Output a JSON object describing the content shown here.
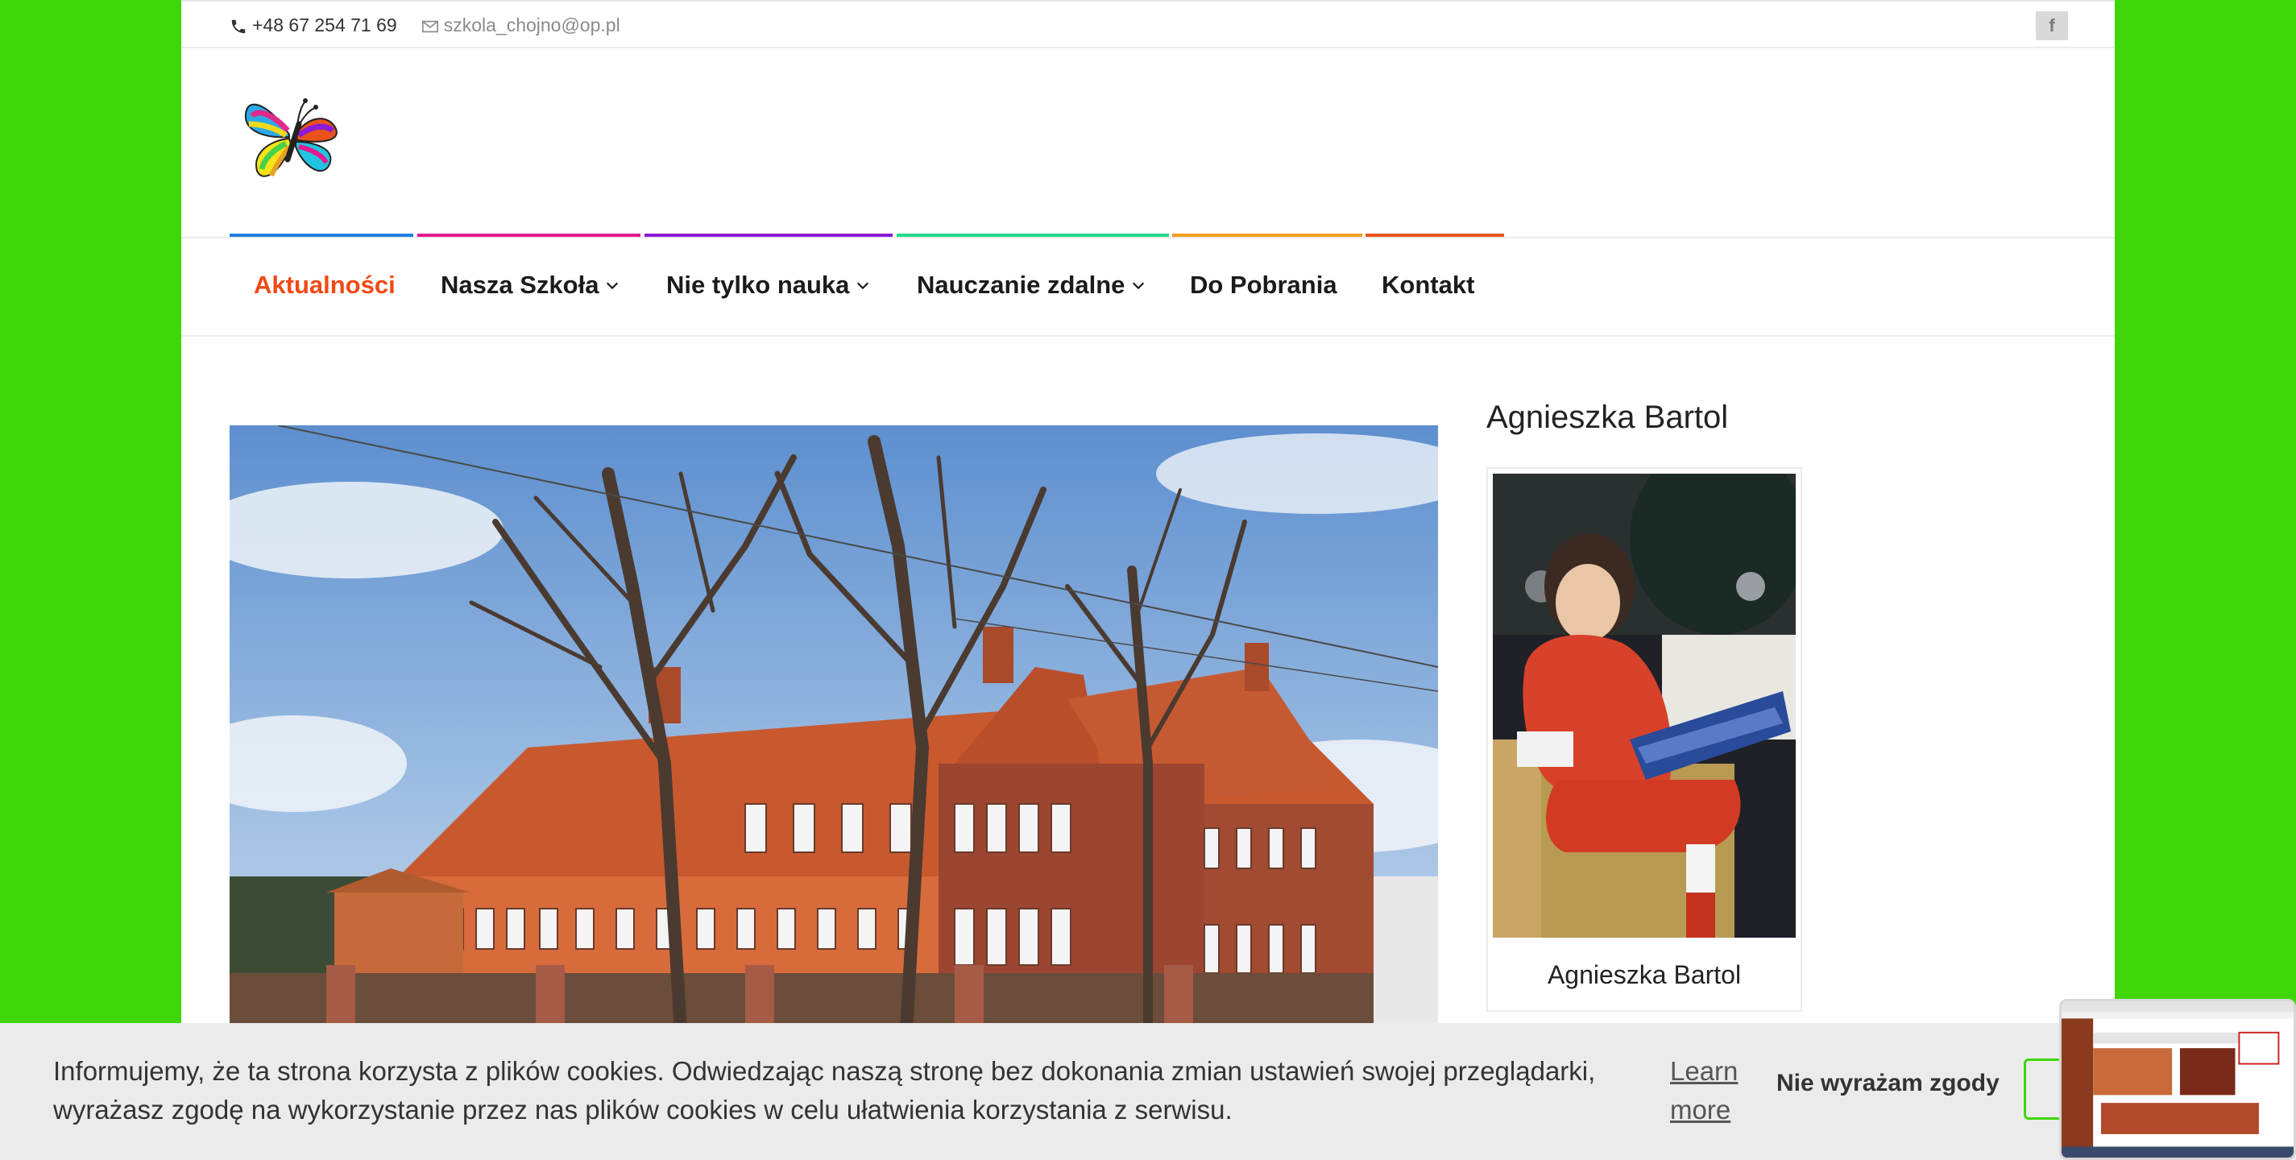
{
  "topbar": {
    "phone": "+48 67 254 71 69",
    "email": "szkola_chojno@op.pl",
    "facebook_label": "f"
  },
  "brand": {
    "logo_icon": "butterfly-logo-icon"
  },
  "nav": {
    "items": [
      {
        "label": "Aktualności",
        "active": true,
        "dropdown": false,
        "bar_color": "#1f7fdc"
      },
      {
        "label": "Nasza Szkoła",
        "active": false,
        "dropdown": true,
        "bar_color": "#e6198e"
      },
      {
        "label": "Nie tylko nauka",
        "active": false,
        "dropdown": true,
        "bar_color": "#8e1ad8"
      },
      {
        "label": "Nauczanie zdalne",
        "active": false,
        "dropdown": true,
        "bar_color": "#21d98a"
      },
      {
        "label": "Do Pobrania",
        "active": false,
        "dropdown": false,
        "bar_color": "#f0a21c"
      },
      {
        "label": "Kontakt",
        "active": false,
        "dropdown": false,
        "bar_color": "#e9521b"
      }
    ],
    "active_color": "#f04a16"
  },
  "sidebar": {
    "title": "Agnieszka Bartol",
    "caption": "Agnieszka Bartol"
  },
  "cookie": {
    "message": "Informujemy, że ta strona korzysta z plików cookies. Odwiedzając naszą stronę bez dokonania zmian ustawień swojej przeglądarki, wyrażasz zgodę na wykorzystanie przez nas plików cookies w celu ułatwienia korzystania z serwisu.",
    "learn_more": "Learn more",
    "deny": "Nie wyrażam zgody"
  },
  "colors": {
    "background": "#3fd609",
    "accent_green": "#3fd609"
  }
}
